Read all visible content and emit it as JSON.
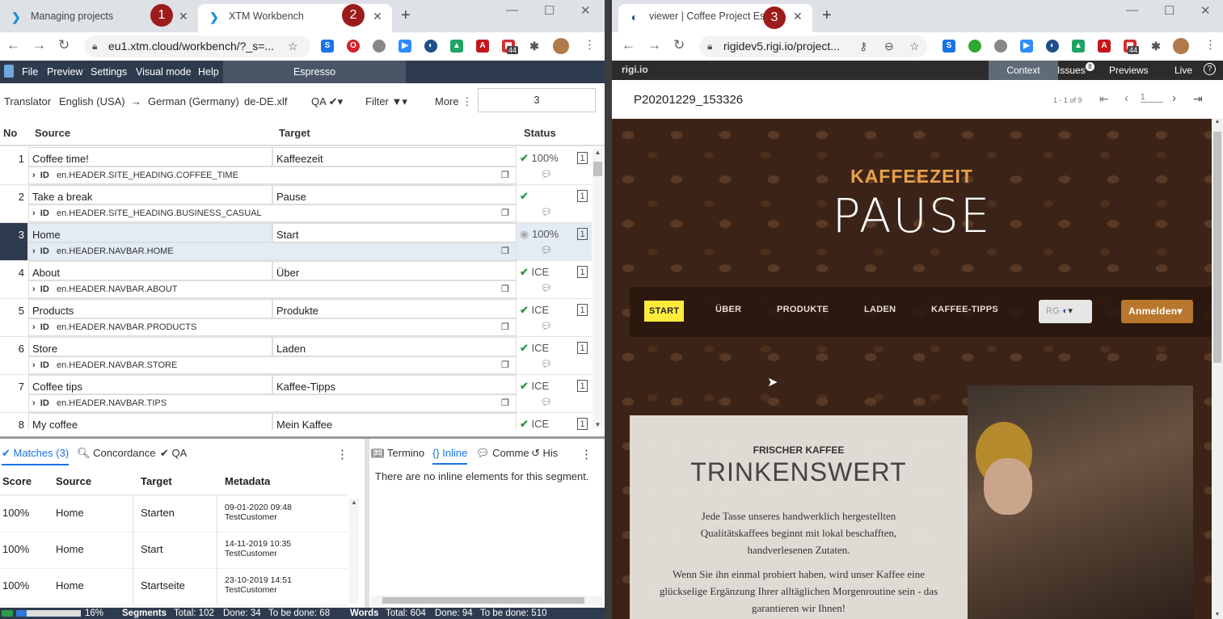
{
  "left_window": {
    "tabs": [
      {
        "label": "Managing projects",
        "badge": "1"
      },
      {
        "label": "XTM Workbench",
        "badge": "2"
      }
    ],
    "url": "eu1.xtm.cloud/workbench/?_s=...",
    "ext_badge": "44",
    "menu": [
      "File",
      "Preview",
      "Settings",
      "Visual mode",
      "Help"
    ],
    "project": "Espresso",
    "toolbar": {
      "role": "Translator",
      "source_lang": "English (USA)",
      "arrow": "→",
      "target_lang": "German (Germany)",
      "file": "de-DE.xlf",
      "qa": "QA",
      "filter": "Filter",
      "more": "More",
      "segment_input": "3"
    },
    "columns": {
      "no": "No",
      "source": "Source",
      "target": "Target",
      "status": "Status"
    },
    "segments": [
      {
        "no": "1",
        "source": "Coffee time!",
        "target": "Kaffeezeit",
        "id": "en.HEADER.SITE_HEADING.COFFEE_TIME",
        "status": "100%"
      },
      {
        "no": "2",
        "source": "Take a break",
        "target": "Pause",
        "id": "en.HEADER.SITE_HEADING.BUSINESS_CASUAL",
        "status": ""
      },
      {
        "no": "3",
        "source": "Home",
        "target": "Start",
        "id": "en.HEADER.NAVBAR.HOME",
        "status": "100%"
      },
      {
        "no": "4",
        "source": "About",
        "target": "Über",
        "id": "en.HEADER.NAVBAR.ABOUT",
        "status": "ICE"
      },
      {
        "no": "5",
        "source": "Products",
        "target": "Produkte",
        "id": "en.HEADER.NAVBAR.PRODUCTS",
        "status": "ICE"
      },
      {
        "no": "6",
        "source": "Store",
        "target": "Laden",
        "id": "en.HEADER.NAVBAR.STORE",
        "status": "ICE"
      },
      {
        "no": "7",
        "source": "Coffee tips",
        "target": "Kaffee-Tipps",
        "id": "en.HEADER.NAVBAR.TIPS",
        "status": "ICE"
      },
      {
        "no": "8",
        "source": "My coffee",
        "target": "Mein Kaffee",
        "id": "",
        "status": "ICE"
      }
    ],
    "id_label": "ID",
    "count_label": "1",
    "bottom_tabs": [
      "Matches (3)",
      "Concordance",
      "QA"
    ],
    "right_tabs": [
      "Termino",
      "Inline",
      "Comme",
      "His"
    ],
    "match_headers": [
      "Score",
      "Source",
      "Target",
      "Metadata"
    ],
    "matches": [
      {
        "score": "100%",
        "source": "Home",
        "target": "Starten",
        "date": "09-01-2020 09:48",
        "customer": "TestCustomer"
      },
      {
        "score": "100%",
        "source": "Home",
        "target": "Start",
        "date": "14-11-2019 10:35",
        "customer": "TestCustomer"
      },
      {
        "score": "100%",
        "source": "Home",
        "target": "Startseite",
        "date": "23-10-2019 14:51",
        "customer": "TestCustomer"
      }
    ],
    "inline_msg": "There are no inline elements for this segment.",
    "status": {
      "progress": "16%",
      "progress_value": 0.16,
      "segments_label": "Segments",
      "seg_total": "Total: 102",
      "seg_done": "Done: 34",
      "seg_todo": "To be done: 68",
      "words_label": "Words",
      "words_total": "Total: 604",
      "words_done": "Done: 94",
      "words_todo": "To be done: 510"
    }
  },
  "right_window": {
    "tab": {
      "label": "viewer | Coffee Project Espr",
      "badge": "3"
    },
    "url": "rigidev5.rigi.io/project...",
    "ext_badge": "44",
    "logo": "rigi.io",
    "nav": {
      "context": "Context",
      "issues": "Issues",
      "issues_count": "8",
      "previews": "Previews",
      "live": "Live"
    },
    "preview_id": "P20201229_153326",
    "pager": {
      "range": "1 - 1 of 9",
      "page": "1"
    },
    "site": {
      "kicker": "KAFFEEZEIT",
      "title": "PAUSE",
      "nav_items": [
        "START",
        "ÜBER",
        "PRODUKTE",
        "LADEN",
        "KAFFEE-TIPPS"
      ],
      "lang_btn": "RG",
      "login": "Anmelden",
      "card_kicker": "FRISCHER KAFFEE",
      "card_title": "TRINKENSWERT",
      "card_p1": "Jede Tasse unseres handwerklich hergestellten Qualitätskaffees beginnt mit lokal beschafften, handverlesenen Zutaten.",
      "card_p2": "Wenn Sie ihn einmal probiert haben, wird unser Kaffee eine glückselige Ergänzung Ihrer alltäglichen Morgenroutine sein - das garantieren wir Ihnen!"
    }
  },
  "colors": {
    "xtm_dark": "#2e3b4e",
    "check": "#2e9a4a",
    "badge": "#9c1c1c",
    "kaffeezeit": "#e8a04a",
    "start_bg": "#ffec3d",
    "login_bg": "#b8772c"
  }
}
